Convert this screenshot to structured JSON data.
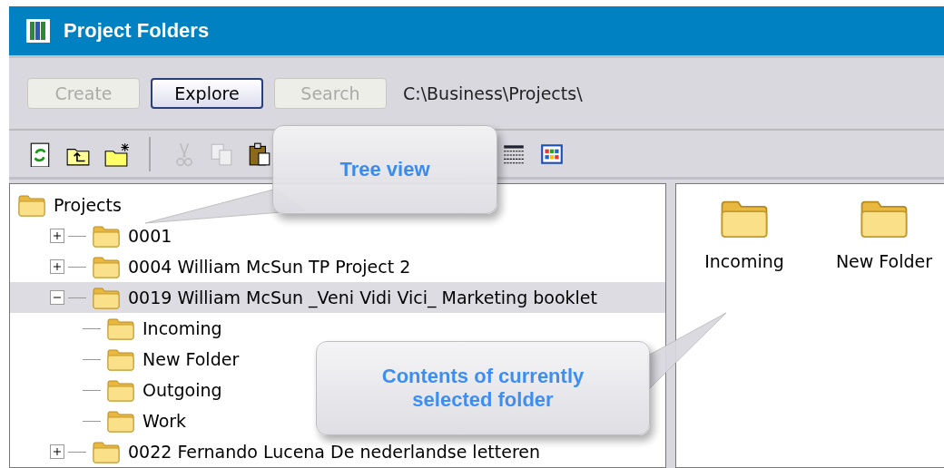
{
  "window": {
    "title": "Project Folders"
  },
  "mode_buttons": [
    {
      "label": "Create",
      "disabled": true,
      "selected": false
    },
    {
      "label": "Explore",
      "disabled": false,
      "selected": true
    },
    {
      "label": "Search",
      "disabled": true,
      "selected": false
    }
  ],
  "path": "C:\\Business\\Projects\\",
  "toolbar": [
    {
      "kind": "refresh",
      "disabled": false
    },
    {
      "kind": "folder-up",
      "disabled": false
    },
    {
      "kind": "new-folder",
      "disabled": false
    },
    {
      "kind": "separator"
    },
    {
      "kind": "cut",
      "disabled": true
    },
    {
      "kind": "copy",
      "disabled": true
    },
    {
      "kind": "paste",
      "disabled": false
    },
    {
      "kind": "details",
      "disabled": false
    },
    {
      "kind": "thumbnails",
      "disabled": false
    }
  ],
  "tree": {
    "label": "Projects",
    "children": [
      {
        "label": "0001",
        "expanded": false,
        "selected": false
      },
      {
        "label": "0004 William McSun TP Project 2",
        "expanded": false,
        "selected": false
      },
      {
        "label": "0019 William McSun _Veni Vidi Vici_ Marketing booklet",
        "expanded": true,
        "selected": true,
        "children": [
          {
            "label": "Incoming",
            "selected": false
          },
          {
            "label": "New Folder",
            "selected": false
          },
          {
            "label": "Outgoing",
            "selected": false
          },
          {
            "label": "Work",
            "selected": false
          }
        ]
      },
      {
        "label": "0022 Fernando Lucena De nederlandse letteren",
        "expanded": false,
        "selected": false
      }
    ]
  },
  "contents": [
    {
      "label": "Incoming"
    },
    {
      "label": "New Folder"
    }
  ],
  "callouts": [
    {
      "text": "Tree view"
    },
    {
      "text": "Contents of currently selected folder"
    }
  ]
}
